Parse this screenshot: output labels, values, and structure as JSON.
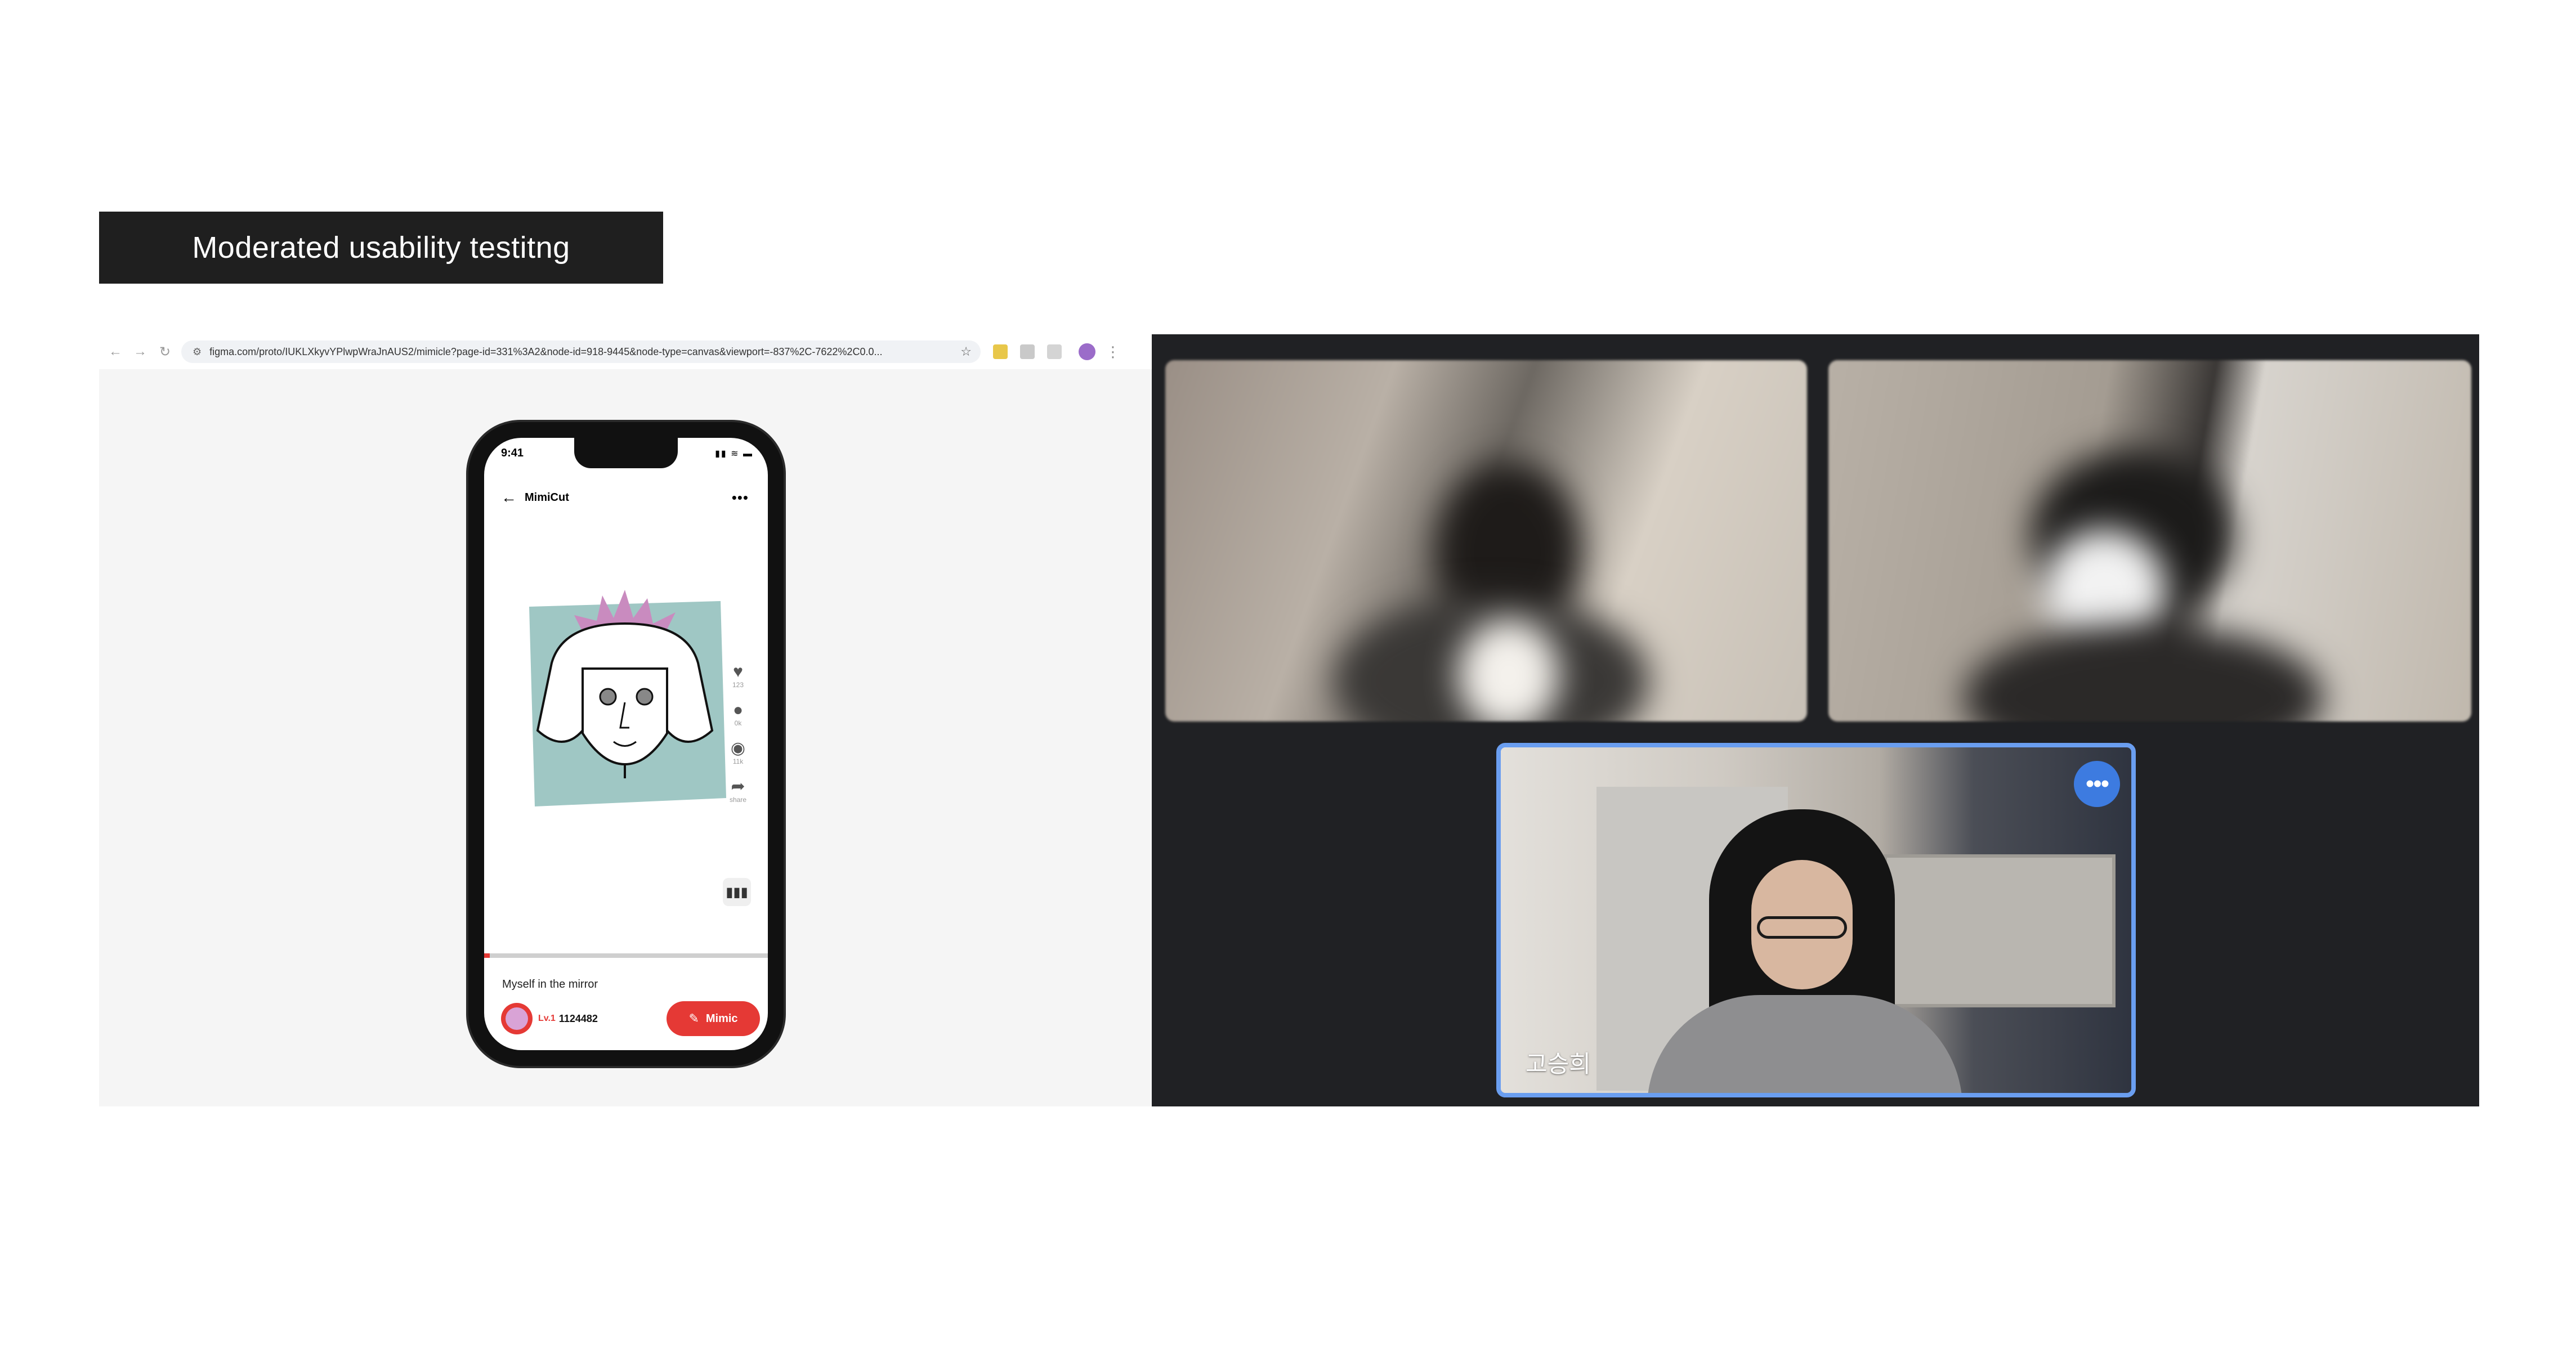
{
  "page": {
    "title": "Moderated usability testitng"
  },
  "browser": {
    "url": "figma.com/proto/IUKLXkyvYPlwpWraJnAUS2/mimicle?page-id=331%3A2&node-id=918-9445&node-type=canvas&viewport=-837%2C-7622%2C0.0..."
  },
  "phone": {
    "status_time": "9:41",
    "app_title": "MimiCut",
    "actions": [
      {
        "icon": "heart-icon",
        "count": "123"
      },
      {
        "icon": "comment-icon",
        "count": "0k"
      },
      {
        "icon": "eye-icon",
        "count": "11k"
      },
      {
        "icon": "share-icon",
        "count": "share"
      }
    ],
    "progress": 0.02,
    "caption": "Myself in the mirror",
    "level": "Lv.1",
    "user_id": "1124482",
    "mimic_label": "Mimic"
  },
  "meeting": {
    "participant_name": "고승희",
    "accent_color": "#6a9ef0"
  }
}
